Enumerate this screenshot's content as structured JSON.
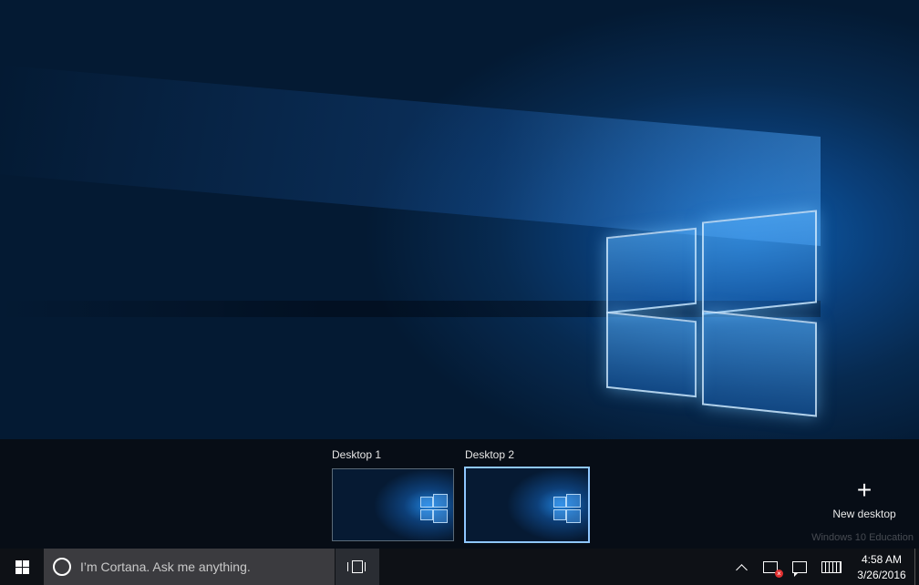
{
  "task_view": {
    "desktops": [
      {
        "label": "Desktop 1",
        "active": false
      },
      {
        "label": "Desktop 2",
        "active": true
      }
    ],
    "new_desktop_label": "New desktop",
    "new_desktop_icon": "plus-icon",
    "watermark": "Windows 10 Education"
  },
  "taskbar": {
    "start_icon": "windows-logo-icon",
    "search_placeholder": "I’m Cortana. Ask me anything.",
    "search_icon": "cortana-circle-icon",
    "task_view_icon": "task-view-icon",
    "tray": {
      "icons": [
        "chevron-up-icon",
        "network-disconnected-icon",
        "action-center-icon",
        "touch-keyboard-icon"
      ],
      "time": "4:58 AM",
      "date": "3/26/2016"
    }
  },
  "colors": {
    "taskbar_bg": "#0e1116",
    "search_bg": "#3b3b3f",
    "active_border": "#8fc7ff",
    "accent_blue": "#1f7fd8"
  }
}
